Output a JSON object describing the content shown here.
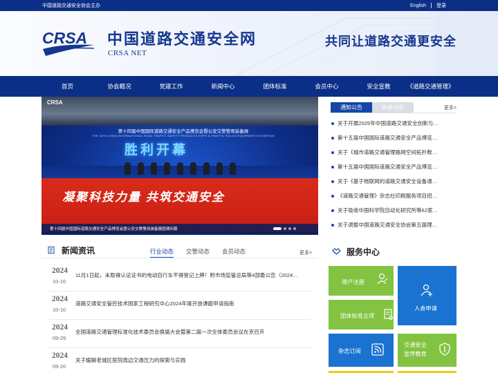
{
  "topbar": {
    "sponsor": "中国道路交通安全协会主办",
    "english": "English",
    "login": "登录"
  },
  "header": {
    "logo_text": "CRSA",
    "title": "中国道路交通安全网",
    "subtitle": "CRSA NET",
    "slogan": "共同让道路交通更安全"
  },
  "nav": [
    "首页",
    "协会概况",
    "党建工作",
    "新闻中心",
    "团体标准",
    "会员中心",
    "安全宣教",
    "《道路交通管理》"
  ],
  "banner": {
    "logo": "CRSA",
    "headline": "第十四届中国国际道路交通安全产品博览会暨公安交警警用装备展",
    "headline_en": "THE 14TH CHINA INTERNATIONAL ROAD TRAFFIC SAFETY PRODUCTS EXPO & TRAFFIC POLICE EQUIPMENT EXHIBITION",
    "big_text": "胜利开幕",
    "red_text": "凝聚科技力量 共筑交通安全",
    "caption": "第十四届中国国际道路交通安全产品博览会暨公安交警警用装备展圆满闭幕",
    "slides": 5,
    "active_slide": 1
  },
  "notice": {
    "tabs": [
      "通知公告",
      "协会动态"
    ],
    "active_tab": 0,
    "more": "更多>",
    "items": [
      "关于开展2025年中国道路交通安全创新与…",
      "第十五届中国国际道路交通安全产品博览…",
      "关于《城市道路交通管理路网空间拓扑数…",
      "第十五届中国国际道路交通安全产品博览…",
      "关于《基于物联网的道路交通安全设备通…",
      "《道路交通管理》杂志社印刷服务项目招…",
      "关于吸收中国科学院自动化研究所等62家…",
      "关于调整中国道路交通安全协会第五届理…"
    ]
  },
  "news": {
    "title": "新闻资讯",
    "tabs": [
      "行业动态",
      "交警动态",
      "会员动态"
    ],
    "active_tab": 0,
    "more": "更多>",
    "items": [
      {
        "year": "2024",
        "date": "10-10",
        "title": "11月1日起，未取得认证证书的电动自行车不得登记上牌！附市场监管总局等4部委公告（2024…"
      },
      {
        "year": "2024",
        "date": "10-10",
        "title": "道路交通安全管控技术国家工程研究中心2024年度开放课题申请指南"
      },
      {
        "year": "2024",
        "date": "09-29",
        "title": "全国道路交通管理标准化技术委员会换届大会暨第二届一次全体委员会议在京召开"
      },
      {
        "year": "2024",
        "date": "09-20",
        "title": "关于缓解老城区医院周边交通压力的探索与实践"
      }
    ]
  },
  "service": {
    "title": "服务中心",
    "tiles": {
      "user_register": "用户注册",
      "member_apply": "入会申请",
      "standard_setup": "团体标准立项",
      "magazine_subscribe": "杂志订阅",
      "safety_education_1": "交通安全",
      "safety_education_2": "宣传教育"
    }
  },
  "colors": {
    "primary": "#0b2f86",
    "accent": "#1546a8",
    "green": "#82c341",
    "blue": "#1a73d0",
    "yellow": "#f2c81c",
    "red": "#d92b1b"
  }
}
